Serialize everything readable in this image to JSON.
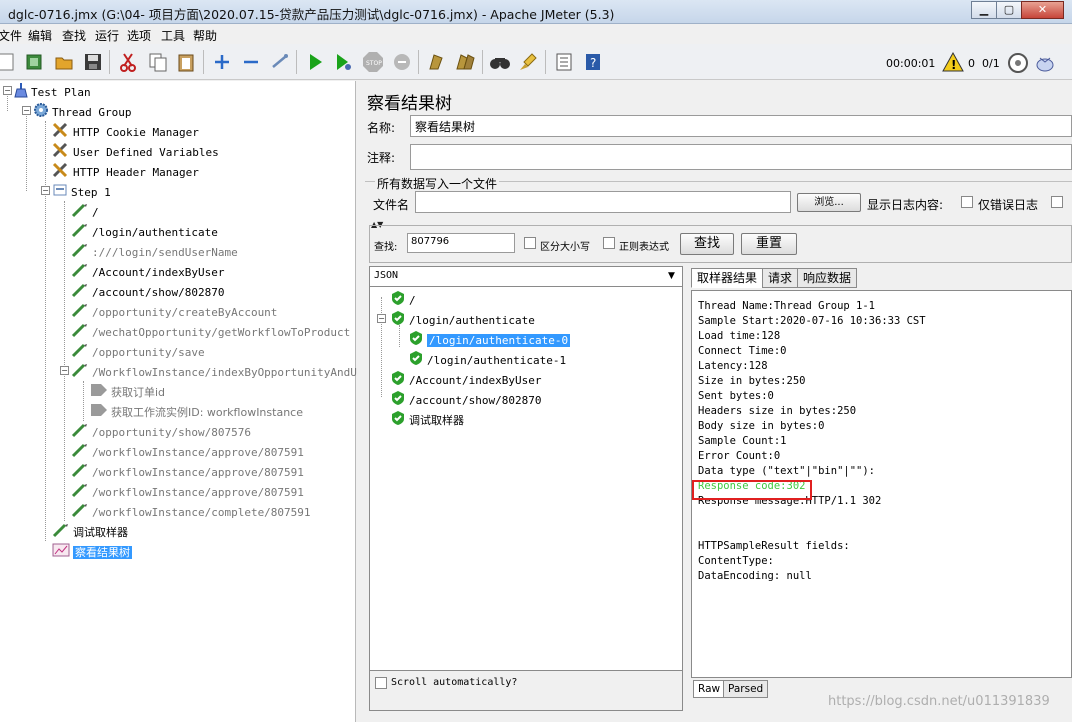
{
  "window": {
    "title": "dglc-0716.jmx (G:\\04- 项目方面\\2020.07.15-贷款产品压力测试\\dglc-0716.jmx) - Apache JMeter (5.3)",
    "controls": [
      "0",
      "1",
      "r"
    ]
  },
  "menu": [
    "文件",
    "编辑",
    "查找",
    "运行",
    "选项",
    "工具",
    "帮助"
  ],
  "toolbar": {
    "icons": [
      "new-icon",
      "templates-icon",
      "open-icon",
      "save-icon",
      "cut-icon",
      "copy-icon",
      "paste-icon",
      "expand-icon",
      "collapse-icon",
      "toggle-icon",
      "start-icon",
      "start-no-pause-icon",
      "stop-icon",
      "shutdown-icon",
      "clear-icon",
      "clear-all-icon",
      "search-icon",
      "reset-search-icon",
      "function-helper-icon",
      "help-icon"
    ],
    "timer": "00:00:01",
    "warning_count": "0",
    "threads": "0/1"
  },
  "tree": {
    "items": [
      {
        "label": "Test Plan",
        "depth": 0,
        "icon": "test-plan-icon",
        "muted": false
      },
      {
        "label": "Thread Group",
        "depth": 1,
        "icon": "gear-icon",
        "muted": false
      },
      {
        "label": "HTTP Cookie Manager",
        "depth": 2,
        "icon": "wrench-icon",
        "muted": false
      },
      {
        "label": "User Defined Variables",
        "depth": 2,
        "icon": "wrench-icon",
        "muted": false
      },
      {
        "label": "HTTP Header Manager",
        "depth": 2,
        "icon": "wrench-icon",
        "muted": false
      },
      {
        "label": "Step 1",
        "depth": 2,
        "icon": "controller-icon",
        "muted": false
      },
      {
        "label": "/",
        "depth": 3,
        "icon": "pipette-icon",
        "muted": false
      },
      {
        "label": "/login/authenticate",
        "depth": 3,
        "icon": "pipette-icon",
        "muted": false
      },
      {
        "label": ":///login/sendUserName",
        "depth": 3,
        "icon": "pipette-icon",
        "muted": true
      },
      {
        "label": "/Account/indexByUser",
        "depth": 3,
        "icon": "pipette-icon",
        "muted": false
      },
      {
        "label": "/account/show/802870",
        "depth": 3,
        "icon": "pipette-icon",
        "muted": false
      },
      {
        "label": "/opportunity/createByAccount",
        "depth": 3,
        "icon": "pipette-icon",
        "muted": true
      },
      {
        "label": "/wechatOpportunity/getWorkflowToProduct",
        "depth": 3,
        "icon": "pipette-icon",
        "muted": true
      },
      {
        "label": "/opportunity/save",
        "depth": 3,
        "icon": "pipette-icon",
        "muted": true
      },
      {
        "label": "/WorkflowInstance/indexByOpportunityAndUser",
        "depth": 3,
        "icon": "pipette-icon",
        "muted": true
      },
      {
        "label": "获取订单id",
        "depth": 4,
        "icon": "extractor-icon",
        "muted": true
      },
      {
        "label": "获取工作流实例ID: workflowInstance",
        "depth": 4,
        "icon": "extractor-icon",
        "muted": true
      },
      {
        "label": "/opportunity/show/807576",
        "depth": 3,
        "icon": "pipette-icon",
        "muted": true
      },
      {
        "label": "/workflowInstance/approve/807591",
        "depth": 3,
        "icon": "pipette-icon",
        "muted": true
      },
      {
        "label": "/workflowInstance/approve/807591",
        "depth": 3,
        "icon": "pipette-icon",
        "muted": true
      },
      {
        "label": "/workflowInstance/approve/807591",
        "depth": 3,
        "icon": "pipette-icon",
        "muted": true
      },
      {
        "label": "/workflowInstance/complete/807591",
        "depth": 3,
        "icon": "pipette-icon",
        "muted": true
      },
      {
        "label": "调试取样器",
        "depth": 2,
        "icon": "pipette-icon",
        "muted": false
      },
      {
        "label": "察看结果树",
        "depth": 2,
        "icon": "graph-icon",
        "muted": false,
        "selected": true
      }
    ]
  },
  "panel": {
    "title": "察看结果树",
    "name_label": "名称:",
    "name_value": "察看结果树",
    "comment_label": "注释:",
    "comment_value": "",
    "file_section_title": "所有数据写入一个文件",
    "filename_label": "文件名",
    "filename_value": "",
    "browse_button": "浏览...",
    "log_content_label": "显示日志内容:",
    "errors_only_label": "仅错误日志"
  },
  "search": {
    "label": "查找:",
    "value": "807796",
    "case_sensitive_label": "区分大小写",
    "regex_label": "正则表达式",
    "find_button": "查找",
    "reset_button": "重置"
  },
  "results": {
    "renderer": "JSON",
    "scroll_label": "Scroll automatically?",
    "items": [
      {
        "label": "/",
        "depth": 0
      },
      {
        "label": "/login/authenticate",
        "depth": 0
      },
      {
        "label": "/login/authenticate-0",
        "depth": 1,
        "selected": true
      },
      {
        "label": "/login/authenticate-1",
        "depth": 1
      },
      {
        "label": "/Account/indexByUser",
        "depth": 0
      },
      {
        "label": "/account/show/802870",
        "depth": 0
      },
      {
        "label": "调试取样器",
        "depth": 0
      }
    ]
  },
  "detail": {
    "tabs": [
      "取样器结果",
      "请求",
      "响应数据"
    ],
    "active_tab": 0,
    "lines": [
      "Thread Name:Thread Group 1-1",
      "Sample Start:2020-07-16 10:36:33 CST",
      "Load time:128",
      "Connect Time:0",
      "Latency:128",
      "Size in bytes:250",
      "Sent bytes:0",
      "Headers size in bytes:250",
      "Body size in bytes:0",
      "Sample Count:1",
      "Error Count:0",
      "Data type (\"text\"|\"bin\"|\"\"):",
      "Response code:302",
      "Response message:HTTP/1.1 302",
      "",
      "",
      "HTTPSampleResult fields:",
      "ContentType:",
      "DataEncoding: null"
    ],
    "highlight_line": 12,
    "highlight_color": "#40c840",
    "bottom_tabs": [
      "Raw",
      "Parsed"
    ]
  },
  "watermark": "https://blog.csdn.net/u011391839"
}
